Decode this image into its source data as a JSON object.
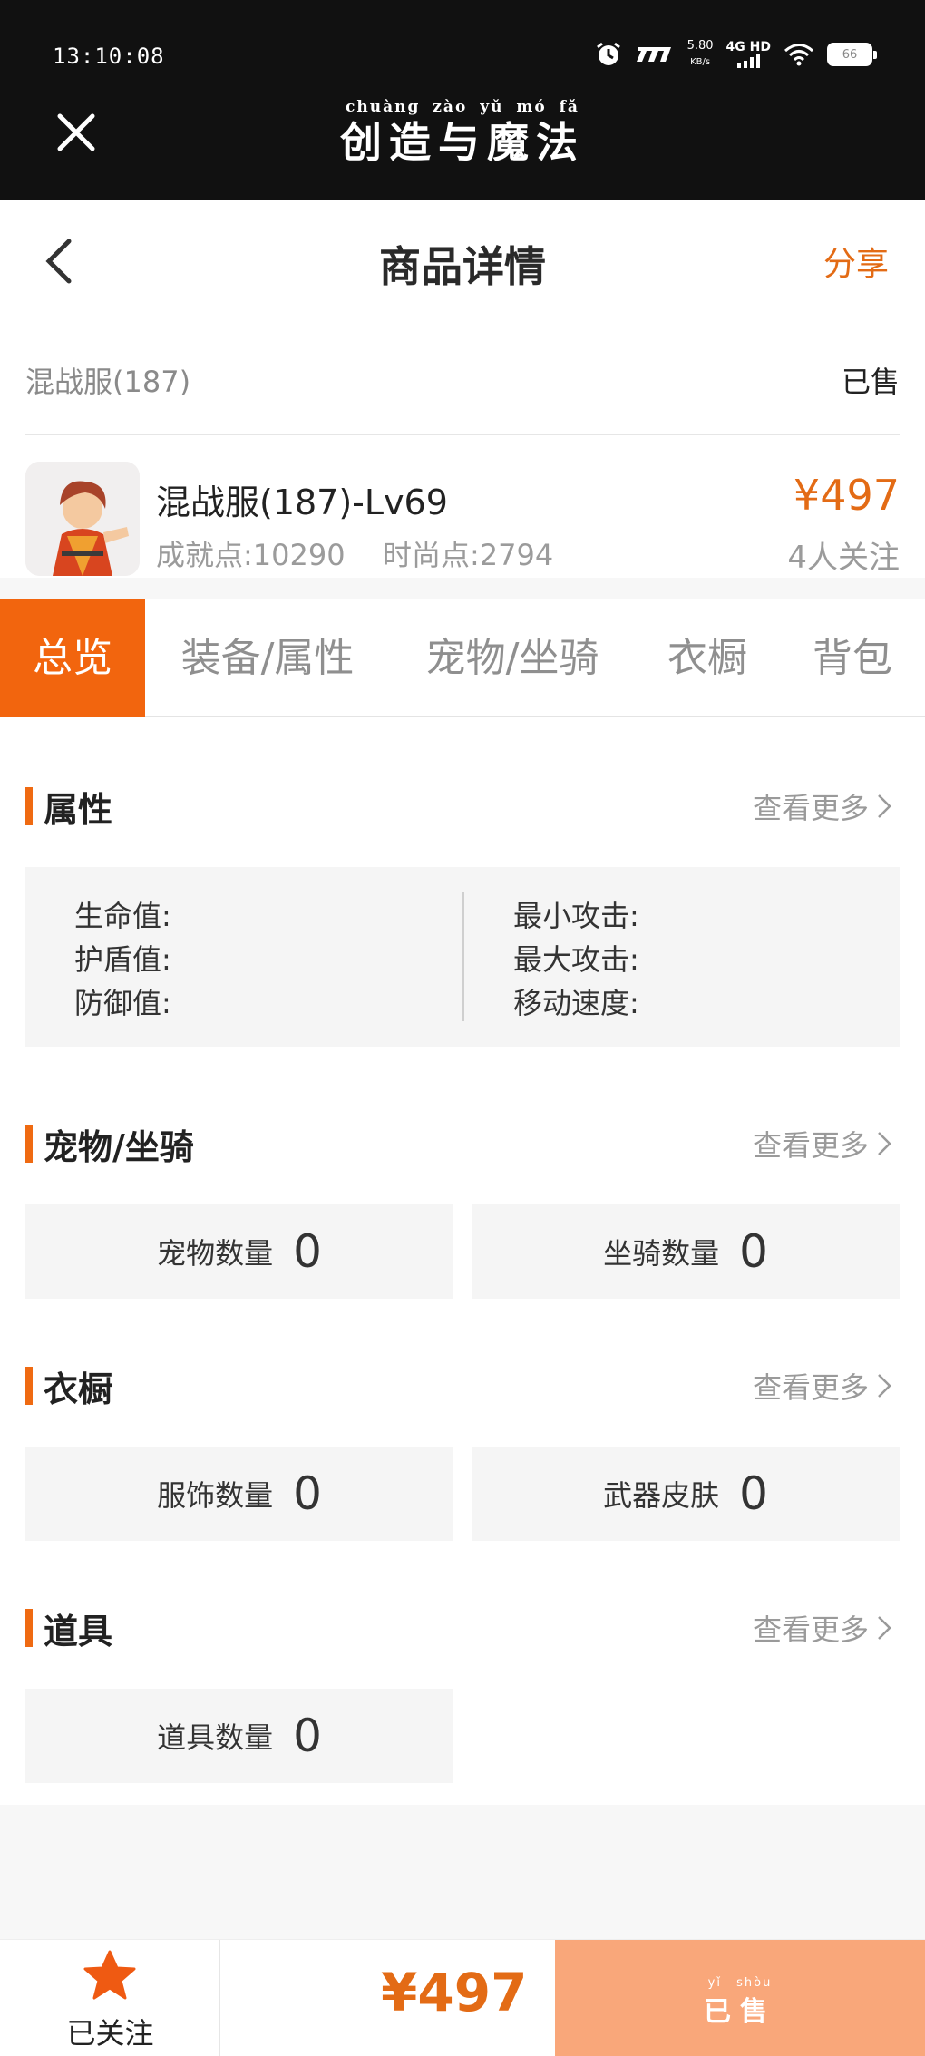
{
  "status_bar": {
    "time": "13:10:08",
    "speed_value": "5.80",
    "speed_unit": "KB/s",
    "network": "4G HD",
    "battery": "66"
  },
  "app": {
    "title": "创造与魔法",
    "title_pinyin": "chuàng zào yǔ mó fǎ"
  },
  "nav": {
    "title": "商品详情",
    "share": "分享"
  },
  "listing": {
    "server": "混战服(187)",
    "status": "已售"
  },
  "product": {
    "name": "混战服(187)-Lv69",
    "achievement": "成就点:10290",
    "fashion": "时尚点:2794",
    "price": "¥497",
    "followers": "4人关注"
  },
  "tabs": [
    {
      "label": "总览"
    },
    {
      "label": "装备/属性"
    },
    {
      "label": "宠物/坐骑"
    },
    {
      "label": "衣橱"
    },
    {
      "label": "背包"
    }
  ],
  "more_label": "查看更多",
  "attributes": {
    "title": "属性",
    "left": [
      "生命值:",
      "护盾值:",
      "防御值:"
    ],
    "right": [
      "最小攻击:",
      "最大攻击:",
      "移动速度:"
    ]
  },
  "pets": {
    "title": "宠物/坐骑",
    "pet_label": "宠物数量",
    "pet_value": "0",
    "mount_label": "坐骑数量",
    "mount_value": "0"
  },
  "wardrobe": {
    "title": "衣橱",
    "outfit_label": "服饰数量",
    "outfit_value": "0",
    "skin_label": "武器皮肤",
    "skin_value": "0"
  },
  "items": {
    "title": "道具",
    "item_label": "道具数量",
    "item_value": "0"
  },
  "bottom_bar": {
    "follow_label": "已关注",
    "price": "¥497",
    "sold_label": "已售",
    "sold_pinyin": "yǐ shòu"
  },
  "colors": {
    "accent": "#f2650e",
    "price": "#e36b15",
    "sold_button": "#f9a77a"
  }
}
